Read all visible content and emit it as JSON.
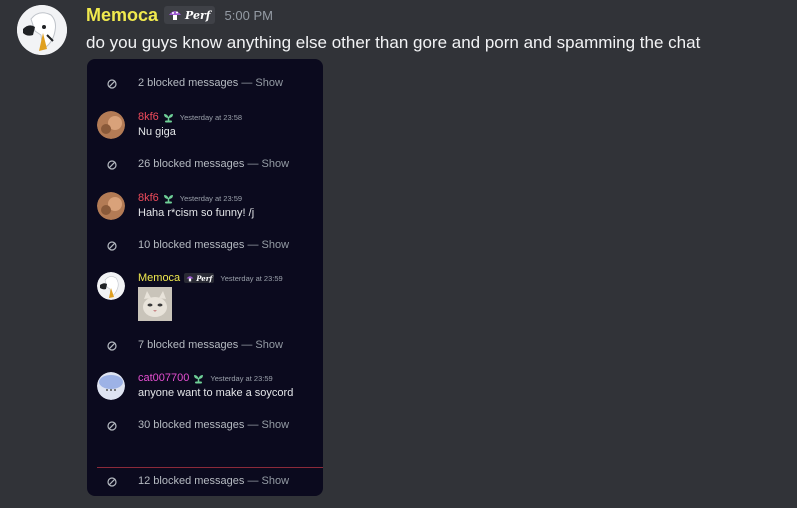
{
  "message": {
    "author": "Memoca",
    "role_tag": "Perf",
    "timestamp": "5:00 PM",
    "text": "do you guys know anything else other than gore and porn and spamming the chat"
  },
  "screenshot": {
    "blocked_rows": [
      {
        "count_text": "2 blocked messages",
        "show_text": " — Show"
      },
      {
        "count_text": "26 blocked messages",
        "show_text": " — Show"
      },
      {
        "count_text": "10 blocked messages",
        "show_text": " — Show"
      },
      {
        "count_text": "7 blocked messages",
        "show_text": " — Show"
      },
      {
        "count_text": "30 blocked messages",
        "show_text": " — Show"
      },
      {
        "count_text": "12 blocked messages",
        "show_text": " — Show"
      }
    ],
    "messages": [
      {
        "author": "8kf6",
        "timestamp": "Yesterday at 23:58",
        "text": "Nu giga"
      },
      {
        "author": "8kf6",
        "timestamp": "Yesterday at 23:59",
        "text": "Haha r*cism so funny! /j"
      },
      {
        "author": "Memoca",
        "role_tag": "Perf",
        "timestamp": "Yesterday at 23:59"
      },
      {
        "author": "cat007700",
        "timestamp": "Yesterday at 23:59",
        "text": "anyone want to make a soycord"
      }
    ]
  },
  "colors": {
    "background": "#313338",
    "attachment_bg": "#0b0a1e",
    "memoca_name": "#f0e94e",
    "kf6_name": "#ef4b5b",
    "cat_name": "#e64fd1",
    "badge_green": "#6fcf97",
    "divider_red": "#8c2a3a"
  },
  "icons": [
    "blocked-icon",
    "plant-badge-icon",
    "mushroom-icon"
  ]
}
